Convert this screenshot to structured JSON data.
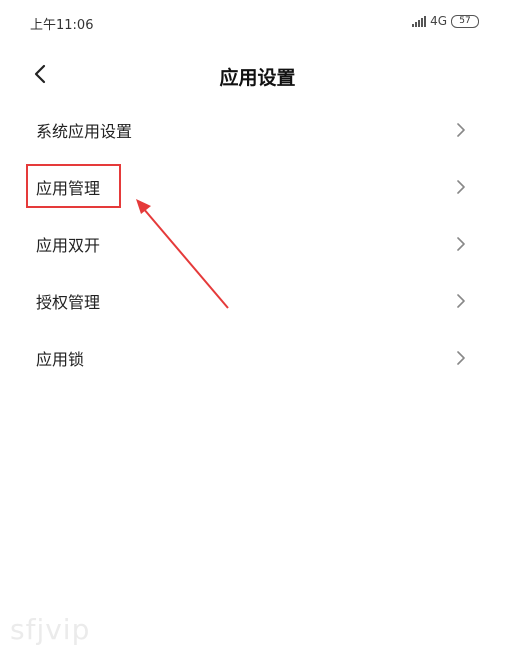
{
  "status_bar": {
    "time": "上午11:06",
    "network": "4G",
    "battery": "57"
  },
  "header": {
    "title": "应用设置"
  },
  "list": {
    "items": [
      {
        "label": "系统应用设置"
      },
      {
        "label": "应用管理"
      },
      {
        "label": "应用双开"
      },
      {
        "label": "授权管理"
      },
      {
        "label": "应用锁"
      }
    ]
  },
  "annotation": {
    "highlight_color": "#e53a3a",
    "highlighted_item": "应用管理"
  },
  "watermark": {
    "text": "sfjvip"
  }
}
